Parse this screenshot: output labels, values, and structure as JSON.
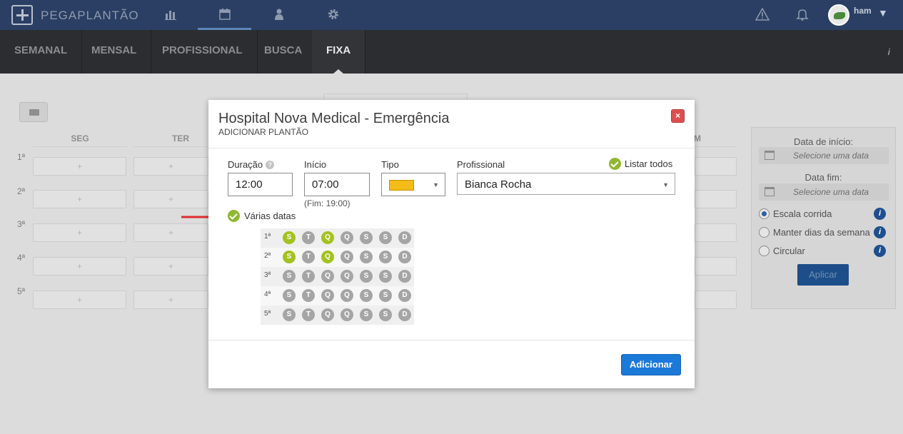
{
  "app": {
    "brand": "PEGAPLANTÃO",
    "user_name": "ham"
  },
  "top_icons": [
    "chart-icon",
    "calendar-icon",
    "user-icon",
    "gear-icon",
    "warning-icon",
    "bell-icon"
  ],
  "subnav": {
    "items": [
      "SEMANAL",
      "MENSAL",
      "PROFISSIONAL",
      "BUSCA",
      "FIXA"
    ],
    "active": "FIXA",
    "info": "i"
  },
  "background": {
    "day_headers": [
      "SEG",
      "TER",
      "M"
    ],
    "row_labels": [
      "1ª",
      "2ª",
      "3ª",
      "4ª",
      "5ª"
    ],
    "cell_symbol": "+"
  },
  "right_panel": {
    "start_label": "Data de início:",
    "start_placeholder": "Selecione uma data",
    "end_label": "Data fim:",
    "end_placeholder": "Selecione uma data",
    "options": [
      {
        "label": "Escala corrida",
        "selected": true
      },
      {
        "label": "Manter dias da semana",
        "selected": false
      },
      {
        "label": "Circular",
        "selected": false
      }
    ],
    "apply_label": "Aplicar"
  },
  "modal": {
    "title": "Hospital Nova Medical - Emergência",
    "subtitle": "ADICIONAR PLANTÃO",
    "close": "×",
    "duracao_label": "Duração",
    "duracao_help": "?",
    "duracao_value": "12:00",
    "inicio_label": "Início",
    "inicio_value": "07:00",
    "fim_text": "(Fim: 19:00)",
    "tipo_label": "Tipo",
    "tipo_color": "#f3bc17",
    "profissional_label": "Profissional",
    "profissional_value": "Bianca Rocha",
    "listar_todos": "Listar todos",
    "varias_datas": "Várias datas",
    "weeks": [
      {
        "label": "1ª",
        "days": [
          {
            "l": "S",
            "on": true
          },
          {
            "l": "T",
            "on": false
          },
          {
            "l": "Q",
            "on": true
          },
          {
            "l": "Q",
            "on": false
          },
          {
            "l": "S",
            "on": false
          },
          {
            "l": "S",
            "on": false
          },
          {
            "l": "D",
            "on": false
          }
        ]
      },
      {
        "label": "2ª",
        "days": [
          {
            "l": "S",
            "on": true
          },
          {
            "l": "T",
            "on": false
          },
          {
            "l": "Q",
            "on": true
          },
          {
            "l": "Q",
            "on": false
          },
          {
            "l": "S",
            "on": false
          },
          {
            "l": "S",
            "on": false
          },
          {
            "l": "D",
            "on": false
          }
        ]
      },
      {
        "label": "3ª",
        "days": [
          {
            "l": "S",
            "on": false
          },
          {
            "l": "T",
            "on": false
          },
          {
            "l": "Q",
            "on": false
          },
          {
            "l": "Q",
            "on": false
          },
          {
            "l": "S",
            "on": false
          },
          {
            "l": "S",
            "on": false
          },
          {
            "l": "D",
            "on": false
          }
        ]
      },
      {
        "label": "4ª",
        "days": [
          {
            "l": "S",
            "on": false
          },
          {
            "l": "T",
            "on": false
          },
          {
            "l": "Q",
            "on": false
          },
          {
            "l": "Q",
            "on": false
          },
          {
            "l": "S",
            "on": false
          },
          {
            "l": "S",
            "on": false
          },
          {
            "l": "D",
            "on": false
          }
        ]
      },
      {
        "label": "5ª",
        "days": [
          {
            "l": "S",
            "on": false
          },
          {
            "l": "T",
            "on": false
          },
          {
            "l": "Q",
            "on": false
          },
          {
            "l": "Q",
            "on": false
          },
          {
            "l": "S",
            "on": false
          },
          {
            "l": "S",
            "on": false
          },
          {
            "l": "D",
            "on": false
          }
        ]
      }
    ],
    "add_label": "Adicionar"
  },
  "colors": {
    "accent_green": "#a3c21f",
    "primary_blue": "#1b79d8",
    "annotation_red": "#e02b2b"
  }
}
